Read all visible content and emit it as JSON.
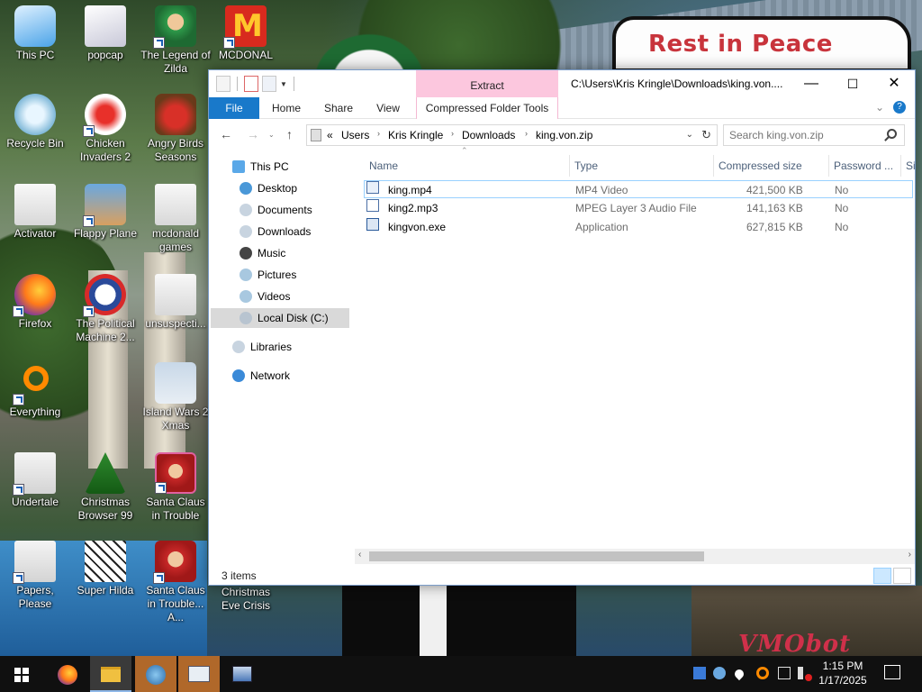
{
  "desktop": {
    "sign_text": "Rest in Peace",
    "watermark": "VMObot",
    "icons": [
      {
        "label": "This PC"
      },
      {
        "label": "popcap"
      },
      {
        "label": "The Legend of Zilda"
      },
      {
        "label": "MCDONAL"
      },
      {
        "label": "Recycle Bin"
      },
      {
        "label": "Chicken Invaders 2"
      },
      {
        "label": "Angry Birds Seasons"
      },
      {
        "label": "Activator"
      },
      {
        "label": "Flappy Plane"
      },
      {
        "label": "mcdonald games"
      },
      {
        "label": "Firefox"
      },
      {
        "label": "The Political Machine 2..."
      },
      {
        "label": "unsuspecti..."
      },
      {
        "label": "Everything"
      },
      {
        "label": "Island Wars 2 Xmas"
      },
      {
        "label": "Undertale"
      },
      {
        "label": "Christmas Browser 99"
      },
      {
        "label": "Santa Claus in Trouble"
      },
      {
        "label": "Papers, Please"
      },
      {
        "label": "Super Hilda"
      },
      {
        "label": "Santa Claus in Trouble... A..."
      },
      {
        "label": "Christmas Eve Crisis"
      }
    ]
  },
  "window": {
    "title": "C:\\Users\\Kris Kringle\\Downloads\\king.von....",
    "context_tab": "Extract",
    "context_group": "Compressed Folder Tools",
    "ribbon_tabs": [
      "File",
      "Home",
      "Share",
      "View"
    ],
    "controls": {
      "minimize": "—",
      "maximize": "☐",
      "close": "✕"
    },
    "breadcrumb": [
      "«",
      "Users",
      "Kris Kringle",
      "Downloads",
      "king.von.zip"
    ],
    "search_placeholder": "Search king.von.zip",
    "nav": {
      "this_pc": "This PC",
      "items": [
        "Desktop",
        "Documents",
        "Downloads",
        "Music",
        "Pictures",
        "Videos",
        "Local Disk (C:)"
      ],
      "libraries": "Libraries",
      "network": "Network"
    },
    "columns": [
      "Name",
      "Type",
      "Compressed size",
      "Password ...",
      "Si"
    ],
    "files": [
      {
        "name": "king.mp4",
        "type": "MP4 Video",
        "size": "421,500 KB",
        "password": "No"
      },
      {
        "name": "king2.mp3",
        "type": "MPEG Layer 3 Audio File",
        "size": "141,163 KB",
        "password": "No"
      },
      {
        "name": "kingvon.exe",
        "type": "Application",
        "size": "627,815 KB",
        "password": "No"
      }
    ],
    "status": "3 items"
  },
  "taskbar": {
    "time": "1:15 PM",
    "date": "1/17/2025"
  },
  "colors": {
    "accent": "#1979ca",
    "context_tab": "#fcc7de",
    "selection": "#cce8ff",
    "taskbar": "#101010"
  }
}
